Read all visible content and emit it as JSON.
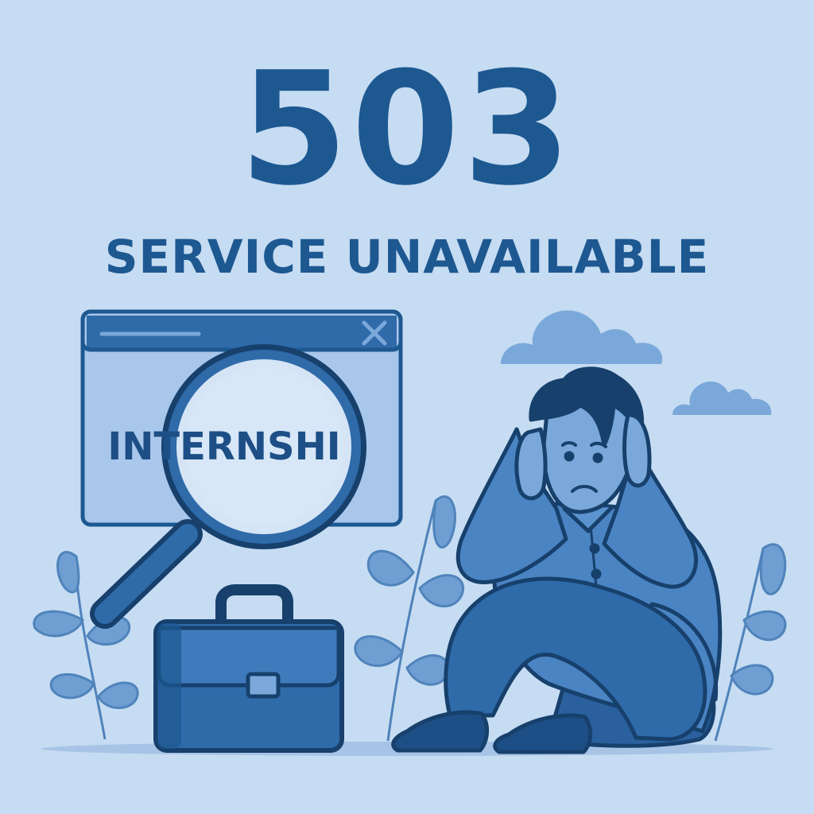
{
  "error": {
    "code": "503",
    "message": "SERVICE UNAVAILABLE"
  },
  "search_window": {
    "text": "INTERNSHI",
    "close_icon": "close-icon"
  },
  "colors": {
    "background": "#c6dcf2",
    "primary": "#1d5891",
    "dark_outline": "#17406c",
    "accent": "#7aa8da"
  }
}
